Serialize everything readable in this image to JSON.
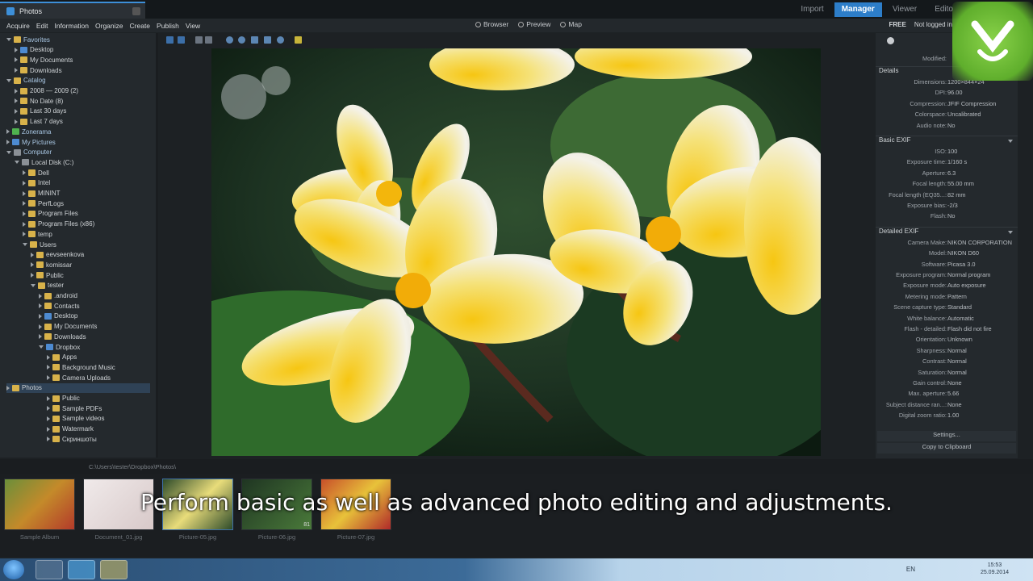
{
  "window": {
    "tab_title": "Photos"
  },
  "modes": [
    "Import",
    "Manager",
    "Viewer",
    "Edito"
  ],
  "menu": [
    "Acquire",
    "Edit",
    "Information",
    "Organize",
    "Create",
    "Publish",
    "View"
  ],
  "views": [
    "Browser",
    "Preview",
    "Map"
  ],
  "account": {
    "plan": "FREE",
    "status": "Not logged in"
  },
  "tree": [
    {
      "label": "Favorites",
      "level": 0,
      "type": "section",
      "expanded": true
    },
    {
      "label": "Desktop",
      "level": 1,
      "icon": "blue"
    },
    {
      "label": "My Documents",
      "level": 1,
      "icon": "folder"
    },
    {
      "label": "Downloads",
      "level": 1,
      "icon": "folder"
    },
    {
      "label": "Catalog",
      "level": 0,
      "type": "section",
      "expanded": true
    },
    {
      "label": "2008 — 2009 (2)",
      "level": 1,
      "icon": "folder"
    },
    {
      "label": "No Date (8)",
      "level": 1,
      "icon": "folder"
    },
    {
      "label": "Last 30 days",
      "level": 1,
      "icon": "folder"
    },
    {
      "label": "Last 7 days",
      "level": 1,
      "icon": "folder"
    },
    {
      "label": "Zonerama",
      "level": 0,
      "type": "section",
      "expanded": false,
      "icon": "green"
    },
    {
      "label": "My Pictures",
      "level": 0,
      "type": "section",
      "expanded": false,
      "icon": "blue"
    },
    {
      "label": "Computer",
      "level": 0,
      "type": "section",
      "expanded": true,
      "icon": "gray"
    },
    {
      "label": "Local Disk (C:)",
      "level": 1,
      "icon": "gray",
      "expanded": true
    },
    {
      "label": "Dell",
      "level": 2,
      "icon": "folder"
    },
    {
      "label": "Intel",
      "level": 2,
      "icon": "folder"
    },
    {
      "label": "MININT",
      "level": 2,
      "icon": "folder"
    },
    {
      "label": "PerfLogs",
      "level": 2,
      "icon": "folder"
    },
    {
      "label": "Program Files",
      "level": 2,
      "icon": "folder"
    },
    {
      "label": "Program Files (x86)",
      "level": 2,
      "icon": "folder"
    },
    {
      "label": "temp",
      "level": 2,
      "icon": "folder"
    },
    {
      "label": "Users",
      "level": 2,
      "icon": "folder",
      "expanded": true
    },
    {
      "label": "eevseenkova",
      "level": 3,
      "icon": "folder"
    },
    {
      "label": "komissar",
      "level": 3,
      "icon": "folder"
    },
    {
      "label": "Public",
      "level": 3,
      "icon": "folder"
    },
    {
      "label": "tester",
      "level": 3,
      "icon": "folder",
      "expanded": true
    },
    {
      "label": ".android",
      "level": 4,
      "icon": "folder"
    },
    {
      "label": "Contacts",
      "level": 4,
      "icon": "folder"
    },
    {
      "label": "Desktop",
      "level": 4,
      "icon": "blue"
    },
    {
      "label": "My Documents",
      "level": 4,
      "icon": "folder"
    },
    {
      "label": "Downloads",
      "level": 4,
      "icon": "folder"
    },
    {
      "label": "Dropbox",
      "level": 4,
      "icon": "blue",
      "expanded": true
    },
    {
      "label": "Apps",
      "level": 5,
      "icon": "folder"
    },
    {
      "label": "Background Music",
      "level": 5,
      "icon": "folder"
    },
    {
      "label": "Camera Uploads",
      "level": 5,
      "icon": "folder"
    },
    {
      "label": "Photos",
      "level": 5,
      "icon": "folder",
      "selected": true
    },
    {
      "label": "Public",
      "level": 5,
      "icon": "folder"
    },
    {
      "label": "Sample PDFs",
      "level": 5,
      "icon": "folder"
    },
    {
      "label": "Sample videos",
      "level": 5,
      "icon": "folder"
    },
    {
      "label": "Watermark",
      "level": 5,
      "icon": "folder"
    },
    {
      "label": "Скриншоты",
      "level": 5,
      "icon": "folder"
    }
  ],
  "panel": {
    "modified_label": "Modified:",
    "details_title": "Details",
    "details": [
      {
        "k": "Dimensions:",
        "v": "1200×844×24"
      },
      {
        "k": "DPI:",
        "v": "96.00"
      },
      {
        "k": "Compression:",
        "v": "JFIF Compression"
      },
      {
        "k": "Colorspace:",
        "v": "Uncalibrated"
      },
      {
        "k": "Audio note:",
        "v": "No"
      }
    ],
    "basic_title": "Basic EXIF",
    "basic": [
      {
        "k": "ISO:",
        "v": "100"
      },
      {
        "k": "Exposure time:",
        "v": "1/160 s"
      },
      {
        "k": "Aperture:",
        "v": "6.3"
      },
      {
        "k": "Focal length:",
        "v": "55.00 mm"
      },
      {
        "k": "Focal length (EQ35...:",
        "v": "82 mm"
      },
      {
        "k": "Exposure bias:",
        "v": "-2/3"
      },
      {
        "k": "Flash:",
        "v": "No"
      }
    ],
    "detailed_title": "Detailed EXIF",
    "detailed": [
      {
        "k": "Camera Make:",
        "v": "NIKON CORPORATION"
      },
      {
        "k": "Model:",
        "v": "NIKON D60"
      },
      {
        "k": "Software:",
        "v": "Picasa 3.0"
      },
      {
        "k": "Exposure program:",
        "v": "Normal program"
      },
      {
        "k": "Exposure mode:",
        "v": "Auto exposure"
      },
      {
        "k": "Metering mode:",
        "v": "Pattern"
      },
      {
        "k": "Scene capture type:",
        "v": "Standard"
      },
      {
        "k": "White balance:",
        "v": "Automatic"
      },
      {
        "k": "Flash - detailed:",
        "v": "Flash did not fire"
      },
      {
        "k": "Orientation:",
        "v": "Unknown"
      },
      {
        "k": "Sharpness:",
        "v": "Normal"
      },
      {
        "k": "Contrast:",
        "v": "Normal"
      },
      {
        "k": "Saturation:",
        "v": "Normal"
      },
      {
        "k": "Gain control:",
        "v": "None"
      },
      {
        "k": "Max. aperture:",
        "v": "5.66"
      },
      {
        "k": "Subject distance ran...:",
        "v": "None"
      },
      {
        "k": "Digital zoom ratio:",
        "v": "1.00"
      }
    ],
    "settings_label": "Settings...",
    "clipboard_label": "Copy to Clipboard"
  },
  "path": "C:\\Users\\tester\\Dropbox\\Photos\\",
  "filmstrip": [
    {
      "label": "Sample Album",
      "kind": "album"
    },
    {
      "label": "Document_01.jpg",
      "kind": "bird"
    },
    {
      "label": "Picture-05.jpg",
      "kind": "flower",
      "selected": true
    },
    {
      "label": "Picture-06.jpg",
      "kind": "leaf",
      "badge": "81"
    },
    {
      "label": "Picture-07.jpg",
      "kind": "red"
    }
  ],
  "caption": "Perform basic as well as advanced photo editing and adjustments.",
  "taskbar": {
    "lang": "EN",
    "time": "15:53",
    "date": "25.09.2014"
  },
  "colors": {
    "accent": "#2d7ec9",
    "logo": "#6cc03a"
  }
}
